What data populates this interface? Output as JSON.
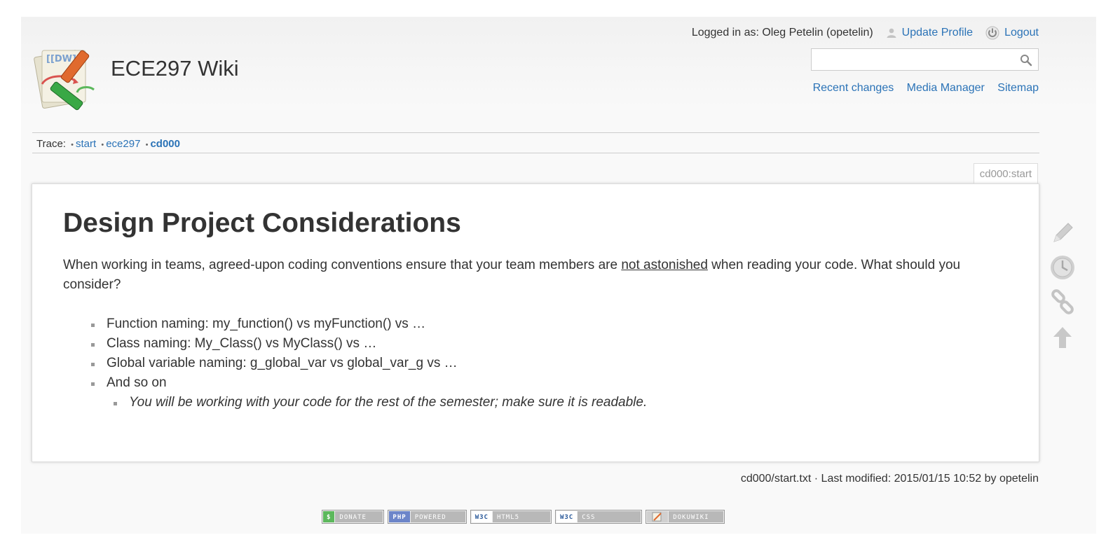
{
  "header": {
    "site_title": "ECE297 Wiki",
    "logo_text": "[[DW]]"
  },
  "user_tools": {
    "logged_in": "Logged in as: Oleg Petelin (opetelin)",
    "update_profile": "Update Profile",
    "logout": "Logout"
  },
  "search": {
    "value": "",
    "placeholder": ""
  },
  "site_tools": {
    "recent_changes": "Recent changes",
    "media_manager": "Media Manager",
    "sitemap": "Sitemap"
  },
  "trace": {
    "label": "Trace:",
    "separator": "•",
    "items": [
      "start",
      "ece297",
      "cd000"
    ]
  },
  "page": {
    "id": "cd000:start",
    "title": "Design Project Considerations",
    "intro_before": "When working in teams, agreed-upon coding conventions ensure that your team members are ",
    "intro_link": "not astonished",
    "intro_after": " when reading your code. What should you consider?",
    "list": [
      "Function naming: my_function() vs myFunction() vs …",
      "Class naming: My_Class() vs MyClass() vs …",
      "Global variable naming: g_global_var vs global_var_g vs …",
      "And so on"
    ],
    "sublist": [
      "You will be working with your code for the rest of the semester; make sure it is readable."
    ]
  },
  "doc_info": "cd000/start.txt · Last modified: 2015/01/15 10:52 by opetelin",
  "badges": [
    {
      "left": "$",
      "right": "DONATE",
      "color": "#5cb85c"
    },
    {
      "left": "PHP",
      "right": "POWERED",
      "color": "#6c85c9"
    },
    {
      "left": "W3C",
      "right": "HTML5",
      "color": "#ffffff"
    },
    {
      "left": "W3C",
      "right": "CSS",
      "color": "#ffffff"
    },
    {
      "left": "",
      "right": "DOKUWIKI",
      "color": "#d0d0d0"
    }
  ],
  "colors": {
    "link": "#2b73b7",
    "text": "#333333",
    "muted": "#999999",
    "tool_icon": "#c8c8c8"
  },
  "page_tool_icons": [
    "edit-icon",
    "revisions-icon",
    "backlinks-icon",
    "back-to-top-icon"
  ]
}
